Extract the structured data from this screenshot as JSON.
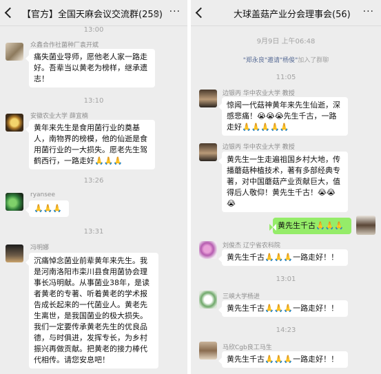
{
  "left": {
    "title": "【官方】全国天麻会议交流群(258)",
    "menu": "···",
    "times": [
      "13:00",
      "13:10",
      "13:26",
      "13:31"
    ],
    "messages": [
      {
        "sender": "众鑫合作社菌种厂袁开斌",
        "text": "痛失菌业导师，愿他老人家一路走好。吾辈当以黄老为榜样，继承遗志！"
      },
      {
        "sender": "安徽农业大学  薛宜楠",
        "text": "黄年来先生是食用菌行业的奠基人，南物界的榜模，他的仙逝是食用菌行业的一大损失。愿老先生驾鹤西行，一路走好🙏🙏🙏"
      },
      {
        "sender": "ryansee",
        "text": "🙏🙏🙏"
      },
      {
        "sender": "冯明娜",
        "text": "沉痛悼念菌业前辈黄年来先生。我是河南洛阳市栾川县食用菌协会理事长冯明献。从事菌业38年，是读者黄老的专著、听着黄老的学术报告成长起来的一代菌业人。黄老先生离世，是我国菌业的极大损失。我们一定要传承黄老先生的优良品德，与时俱进，发挥专长，为乡村振兴再做贡献。把黄老的接力棒代代相传。请您安息吧！"
      }
    ]
  },
  "right": {
    "title": "大球盖菇产业分会理事会(56)",
    "menu": "···",
    "sys_time": "9月9日 上午06:48",
    "sys_names": "\"郑永良\"邀请\"杨俊\"",
    "sys_action": "加入了群聊",
    "times": [
      "11:05",
      "13:01",
      "14:23"
    ],
    "messages": [
      {
        "sender": "边银丙 华中农业大学 教授",
        "text": "惊闻一代菇神黄年来先生仙逝，深感悲痛！😭😭😭先生千古，一路走好🙏🙏🙏🙏🙏"
      },
      {
        "sender": "边银丙 华中农业大学 教授",
        "text": "黄先生一生走遍祖国乡村大地，传播蘑菇种植技术，著有多部经典专著，对中国蘑菇产业贡献巨大，值得后人敬仰！黄先生千古！😭😭😭"
      },
      {
        "sender": "",
        "text": "黄先生千古🙏🙏🙏"
      },
      {
        "sender": "刘俊杰  辽宁省农科院",
        "text": "黄先生千古🙏🙏🙏一路走好！！"
      },
      {
        "sender": "三峡大学杨进",
        "text": "黄先生千古🙏🙏🙏一路走好！！"
      },
      {
        "sender": "马欣Cgb良工马生",
        "text": "黄先生千古🙏🙏🙏一路走好！！"
      }
    ]
  }
}
